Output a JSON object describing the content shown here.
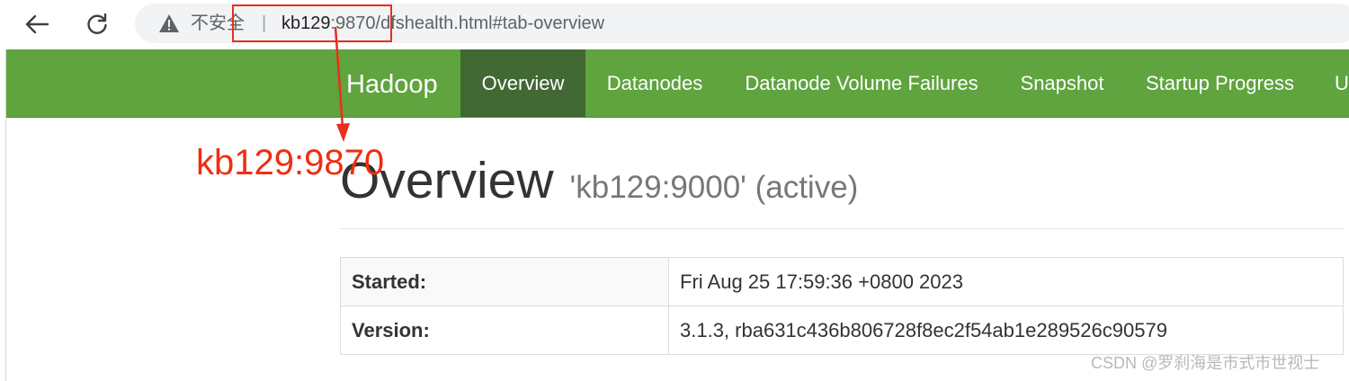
{
  "browser": {
    "security_label": "不安全",
    "separator": "|",
    "url_host": "kb129",
    "url_path": ":9870/dfshealth.html#tab-overview"
  },
  "annotation": {
    "label": "kb129:9870",
    "color": "#f02d10"
  },
  "navbar": {
    "brand": "Hadoop",
    "items": [
      {
        "label": "Overview",
        "active": true
      },
      {
        "label": "Datanodes",
        "active": false
      },
      {
        "label": "Datanode Volume Failures",
        "active": false
      },
      {
        "label": "Snapshot",
        "active": false
      },
      {
        "label": "Startup Progress",
        "active": false
      },
      {
        "label": "U",
        "active": false
      }
    ],
    "color": "#5fa43e",
    "active_color": "#426834"
  },
  "overview": {
    "title": "Overview",
    "subtitle": "'kb129:9000' (active)"
  },
  "info_table": {
    "rows": [
      {
        "key": "Started:",
        "value": "Fri Aug 25 17:59:36 +0800 2023"
      },
      {
        "key": "Version:",
        "value": "3.1.3, rba631c436b806728f8ec2f54ab1e289526c90579"
      }
    ]
  },
  "watermark": "CSDN @罗刹海是市式市世视士"
}
